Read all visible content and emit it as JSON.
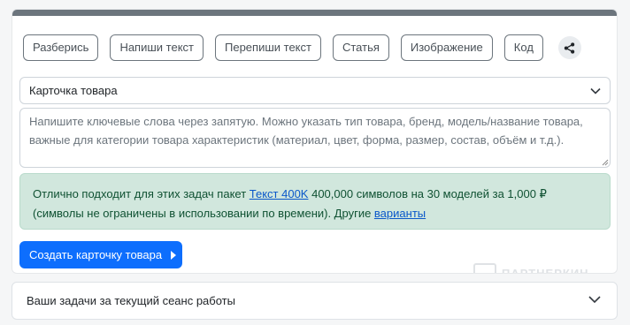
{
  "tabs": [
    {
      "label": "Разберись"
    },
    {
      "label": "Напиши текст"
    },
    {
      "label": "Перепиши текст"
    },
    {
      "label": "Статья"
    },
    {
      "label": "Изображение"
    },
    {
      "label": "Код"
    }
  ],
  "select": {
    "value": "Карточка товара"
  },
  "textarea": {
    "placeholder": "Напишите ключевые слова через запятую. Можно указать тип товара, бренд, модель/название товара, важные для категории товара характеристик (материал, цвет, форма, размер, состав, объём и т.д.)."
  },
  "alert": {
    "text_before": "Отлично подходит для этих задач пакет ",
    "link": "Текст 400K",
    "text_middle": " 400,000 символов на 30 моделей за 1,000 ₽ (символы не ограничены в использовании по времени). Другие ",
    "link2": "варианты"
  },
  "primary_button": {
    "label": "Создать карточку товара"
  },
  "watermark": {
    "text": "ПАРТНЕРКИН"
  },
  "accordion": {
    "label": "Ваши задачи за текущий сеанс работы"
  },
  "colors": {
    "primary": "#0d6efd",
    "alert_bg": "#d1e7dd",
    "topbar": "#6c757d"
  },
  "icons": {
    "share": "share-icon",
    "chevron": "chevron-down-icon",
    "play": "caret-right-icon"
  }
}
